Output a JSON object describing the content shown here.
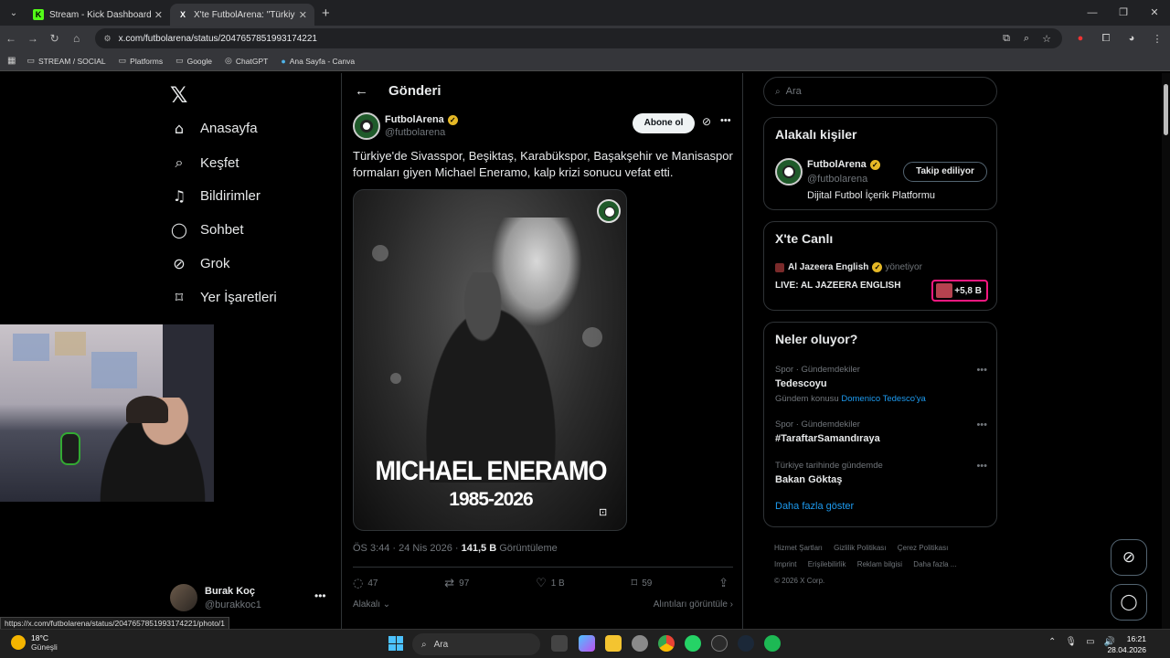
{
  "browser": {
    "tabs": [
      {
        "title": "Stream - Kick Dashboard",
        "favicon": "kick-icon",
        "active": false
      },
      {
        "title": "X'te FutbolArena: \"Türkiye'de Si",
        "favicon": "x-icon",
        "active": true
      }
    ],
    "url": "x.com/futbolarena/status/2047657851993174221",
    "bookmarks": [
      "STREAM / SOCIAL",
      "Platforms",
      "Google",
      "ChatGPT",
      "Ana Sayfa - Canva"
    ],
    "status_url": "https://x.com/futbolarena/status/2047657851993174221/photo/1"
  },
  "nav": {
    "logo": "𝕏",
    "items": [
      {
        "label": "Anasayfa",
        "icon": "⌂"
      },
      {
        "label": "Keşfet",
        "icon": "⌕"
      },
      {
        "label": "Bildirimler",
        "icon": "🔔"
      },
      {
        "label": "Sohbet",
        "icon": "◯"
      },
      {
        "label": "Grok",
        "icon": "⊘"
      },
      {
        "label": "Yer İşaretleri",
        "icon": "⌑"
      }
    ],
    "profile": {
      "name": "Burak Koç",
      "handle": "@burakkoc1"
    }
  },
  "post": {
    "header": "Gönderi",
    "author": {
      "name": "FutbolArena",
      "handle": "@futbolarena"
    },
    "subscribe_label": "Abone ol",
    "text": "Türkiye'de Sivasspor, Beşiktaş, Karabükspor, Başakşehir ve Manisaspor formaları giyen Michael Eneramo, kalp krizi sonucu vefat etti.",
    "image_name": "MICHAEL ENERAMO",
    "image_years": "1985-2026",
    "time": "ÖS 3:44 · 24 Nis 2026 · ",
    "views": "141,5 B",
    "views_label": " Görüntüleme",
    "stats": {
      "replies": "47",
      "reposts": "97",
      "likes": "1 B",
      "bookmarks": "59"
    },
    "related_label": "Alakalı",
    "quotes_label": "Alıntıları görüntüle"
  },
  "sidebar": {
    "search_placeholder": "Ara",
    "related_title": "Alakalı kişiler",
    "related_person": {
      "name": "FutbolArena",
      "handle": "@futbolarena",
      "bio": "Dijital Futbol İçerik Platformu",
      "follow_label": "Takip ediliyor"
    },
    "live_title": "X'te Canlı",
    "live": {
      "host": "Al Jazeera English",
      "role": "yönetiyor",
      "title": "LIVE: AL JAZEERA ENGLISH",
      "count": "+5,8 B"
    },
    "trends_title": "Neler oluyor?",
    "trends": [
      {
        "category": "Spor · Gündemdekiler",
        "name": "Tedescoyu",
        "sub_prefix": "Gündem konusu ",
        "sub_link": "Domenico Tedesco'ya"
      },
      {
        "category": "Spor · Gündemdekiler",
        "name": "#TaraftarSamandıraya",
        "sub_prefix": "",
        "sub_link": ""
      },
      {
        "category": "Türkiye tarihinde gündemde",
        "name": "Bakan Göktaş",
        "sub_prefix": "",
        "sub_link": ""
      }
    ],
    "show_more": "Daha fazla göster",
    "footer": [
      "Hizmet Şartları",
      "Gizlilik Politikası",
      "Çerez Politikası",
      "Imprint",
      "Erişilebilirlik",
      "Reklam bilgisi",
      "Daha fazla ...",
      "© 2026 X Corp."
    ]
  },
  "taskbar": {
    "weather_temp": "18°C",
    "weather_cond": "Güneşli",
    "search_placeholder": "Ara",
    "time": "16:21",
    "date": "28.04.2026"
  }
}
